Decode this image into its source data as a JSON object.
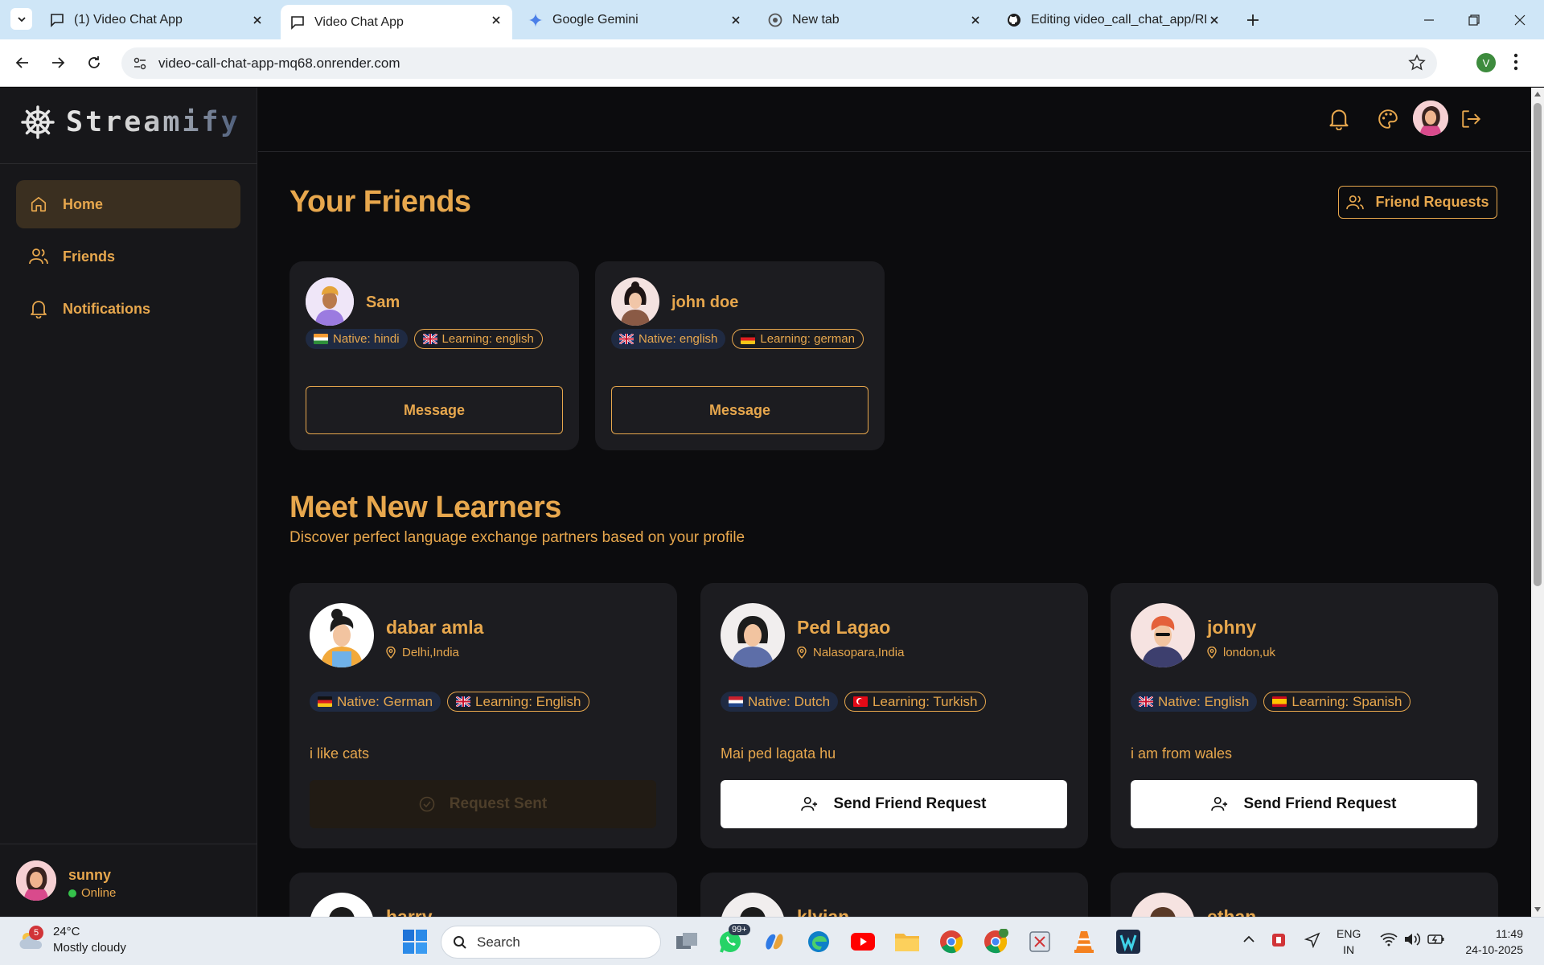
{
  "browser": {
    "tabs": [
      {
        "title": "(1) Video Chat App",
        "icon": "chat-icon"
      },
      {
        "title": "Video Chat App",
        "icon": "chat-icon",
        "active": true
      },
      {
        "title": "Google Gemini",
        "icon": "gemini-icon"
      },
      {
        "title": "New tab",
        "icon": "chrome-icon"
      },
      {
        "title": "Editing video_call_chat_app/RE/",
        "icon": "github-icon"
      }
    ],
    "url": "video-call-chat-app-mq68.onrender.com",
    "profile_initial": "V"
  },
  "sidebar": {
    "brand": "Streamify",
    "items": [
      {
        "label": "Home",
        "icon": "home-icon",
        "active": true
      },
      {
        "label": "Friends",
        "icon": "users-icon"
      },
      {
        "label": "Notifications",
        "icon": "bell-icon"
      }
    ],
    "user": {
      "name": "sunny",
      "status": "Online"
    }
  },
  "main": {
    "friends_title": "Your Friends",
    "friend_requests_label": "Friend Requests",
    "friends": [
      {
        "name": "Sam",
        "native": "Native: hindi",
        "native_flag": "india",
        "learning": "Learning: english",
        "learning_flag": "uk",
        "button": "Message"
      },
      {
        "name": "john doe",
        "native": "Native: english",
        "native_flag": "uk",
        "learning": "Learning: german",
        "learning_flag": "germany",
        "button": "Message"
      }
    ],
    "learners_title": "Meet New Learners",
    "learners_subtitle": "Discover perfect language exchange partners based on your profile",
    "learners": [
      {
        "name": "dabar amla",
        "location": "Delhi,India",
        "native": "Native: German",
        "native_flag": "germany",
        "learning": "Learning: English",
        "learning_flag": "uk",
        "bio": "i like cats",
        "button": "Request Sent",
        "sent": true
      },
      {
        "name": "Ped Lagao",
        "location": "Nalasopara,India",
        "native": "Native: Dutch",
        "native_flag": "netherlands",
        "learning": "Learning: Turkish",
        "learning_flag": "turkey",
        "bio": "Mai ped lagata hu",
        "button": "Send Friend Request",
        "sent": false
      },
      {
        "name": "johny",
        "location": "london,uk",
        "native": "Native: English",
        "native_flag": "uk",
        "learning": "Learning: Spanish",
        "learning_flag": "spain",
        "bio": "i am from wales",
        "button": "Send Friend Request",
        "sent": false
      }
    ],
    "more_learners": [
      "harry",
      "klyian",
      "ethan"
    ]
  },
  "taskbar": {
    "weather_temp": "24°C",
    "weather_desc": "Mostly cloudy",
    "weather_badge": "5",
    "search_placeholder": "Search",
    "whatsapp_badge": "99+",
    "lang_top": "ENG",
    "lang_bottom": "IN",
    "time": "11:49",
    "date": "24-10-2025"
  },
  "colors": {
    "accent": "#e7a74d",
    "background": "#0c0c0e",
    "card": "#1c1c20",
    "sidebar": "#17171a",
    "online": "#35c24b"
  }
}
